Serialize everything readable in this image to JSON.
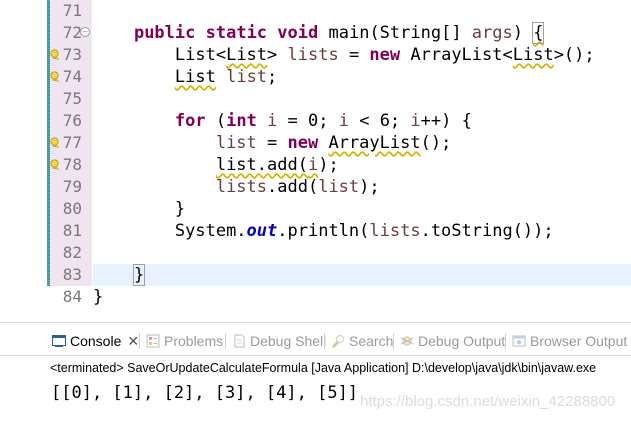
{
  "editor": {
    "lines": [
      {
        "num": "71",
        "changed": true,
        "warn": false,
        "fold": false
      },
      {
        "num": "72",
        "changed": true,
        "warn": false,
        "fold": true
      },
      {
        "num": "73",
        "changed": true,
        "warn": true,
        "fold": false
      },
      {
        "num": "74",
        "changed": true,
        "warn": true,
        "fold": false
      },
      {
        "num": "75",
        "changed": true,
        "warn": false,
        "fold": false
      },
      {
        "num": "76",
        "changed": true,
        "warn": false,
        "fold": false
      },
      {
        "num": "77",
        "changed": true,
        "warn": true,
        "fold": false
      },
      {
        "num": "78",
        "changed": true,
        "warn": true,
        "fold": false
      },
      {
        "num": "79",
        "changed": true,
        "warn": false,
        "fold": false
      },
      {
        "num": "80",
        "changed": true,
        "warn": false,
        "fold": false
      },
      {
        "num": "81",
        "changed": true,
        "warn": false,
        "fold": false
      },
      {
        "num": "82",
        "changed": true,
        "warn": false,
        "fold": false
      },
      {
        "num": "83",
        "changed": true,
        "warn": false,
        "fold": false
      },
      {
        "num": "84",
        "changed": false,
        "warn": false,
        "fold": false
      }
    ],
    "code": {
      "l72": {
        "kw1": "public",
        "kw2": "static",
        "kw3": "void",
        "name": "main(String[] ",
        "param": "args",
        "tail": ") ",
        "brace": "{"
      },
      "l73": {
        "pre": "List<",
        "warn_type": "List",
        "mid": "> ",
        "var": "lists",
        "eq": " = ",
        "kw": "new",
        "mid2": " ArrayList<",
        "warn_type2": "List",
        "tail": ">();"
      },
      "l74": {
        "warn_type": "List",
        "mid": " ",
        "var": "list",
        "tail": ";"
      },
      "l76": {
        "kw": "for",
        "mid": " (",
        "kw2": "int",
        "mid2": " ",
        "var": "i",
        "mid3": " = 0; ",
        "var2": "i",
        "mid4": " < 6; ",
        "var3": "i",
        "tail": "++) {"
      },
      "l77": {
        "var": "list",
        "eq": " = ",
        "kw": "new",
        "sp": " ",
        "warn_type": "ArrayList",
        "tail": "();"
      },
      "l78": {
        "warn_text": "list.add(",
        "var": "i",
        "tail": ");"
      },
      "l79": {
        "var": "lists",
        "mid": ".add(",
        "var2": "list",
        "tail": ");"
      },
      "l80": {
        "text": "}"
      },
      "l81": {
        "pre": "System.",
        "field": "out",
        "mid": ".println(",
        "var": "lists",
        "tail": ".toString());"
      },
      "l83": {
        "text": "}"
      },
      "l84": {
        "text": "}"
      }
    }
  },
  "console": {
    "tabs": [
      {
        "label": "Console",
        "icon": "console-icon",
        "active": true
      },
      {
        "label": "Problems",
        "icon": "problems-icon",
        "active": false
      },
      {
        "label": "Debug Shell",
        "icon": "debug-shell-icon",
        "active": false
      },
      {
        "label": "Search",
        "icon": "search-icon",
        "active": false
      },
      {
        "label": "Debug Output",
        "icon": "debug-output-icon",
        "active": false
      },
      {
        "label": "Browser Output",
        "icon": "browser-output-icon",
        "active": false
      }
    ],
    "close_symbol": "✕",
    "description": "<terminated> SaveOrUpdateCalculateFormula [Java Application] D:\\develop\\java\\jdk\\bin\\javaw.exe",
    "output": "[[0], [1], [2], [3], [4], [5]]",
    "watermark": "https://blog.csdn.net/weixin_42288800"
  },
  "colors": {
    "keyword": "#7f0055",
    "static_field": "#0000c0",
    "local_variable": "#6a3e3e",
    "line_number": "#787878",
    "warning_underline": "#d4b000",
    "current_line": "#e8f2fe",
    "change_ruler": "#3a8d8d"
  }
}
